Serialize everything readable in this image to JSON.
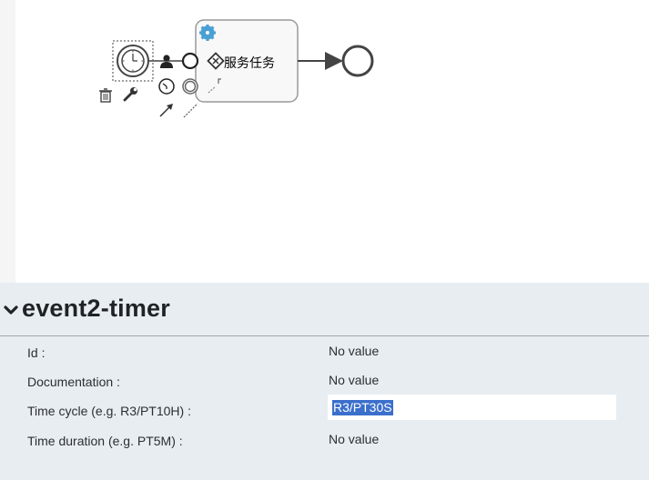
{
  "diagram": {
    "service_task_label": "服务任务",
    "colors": {
      "gear": "#4aa0d5",
      "stroke": "#444444",
      "task_border": "#999999",
      "task_fill": "#f8f8f8"
    }
  },
  "panel": {
    "title": "event2-timer",
    "properties": [
      {
        "label": "Id :",
        "value": "No value"
      },
      {
        "label": "Documentation :",
        "value": "No value"
      },
      {
        "label": "Time cycle (e.g. R3/PT10H) :",
        "value": "R3/PT30S"
      },
      {
        "label": "Time duration (e.g. PT5M) :",
        "value": "No value"
      }
    ]
  },
  "colors": {
    "panel_bg": "#e8edf1",
    "selection": "#3b6fcc"
  }
}
